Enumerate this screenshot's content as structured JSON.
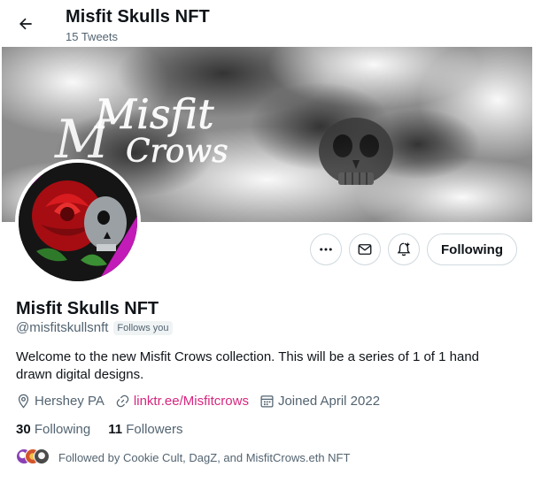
{
  "header": {
    "title": "Misfit Skulls NFT",
    "tweet_count": "15 Tweets"
  },
  "banner": {
    "script_text_line1": "Misfit",
    "script_text_line2": "Crows"
  },
  "actions": {
    "following_label": "Following"
  },
  "profile": {
    "name": "Misfit Skulls NFT",
    "handle": "@misfitskullsnft",
    "follows_you": "Follows you",
    "bio": "Welcome to the new Misfit Crows collection. This will be a series of 1 of 1 hand drawn digital designs.",
    "location": "Hershey PA",
    "link": "linktr.ee/Misfitcrows",
    "joined": "Joined April 2022"
  },
  "stats": {
    "following_count": "30",
    "following_label": "Following",
    "followers_count": "11",
    "followers_label": "Followers"
  },
  "followed_by": {
    "text": "Followed by Cookie Cult, DagZ, and MisfitCrows.eth NFT"
  },
  "colors": {
    "link": "#d6267f",
    "secondary_text": "#536471",
    "border": "#cfd9de"
  }
}
